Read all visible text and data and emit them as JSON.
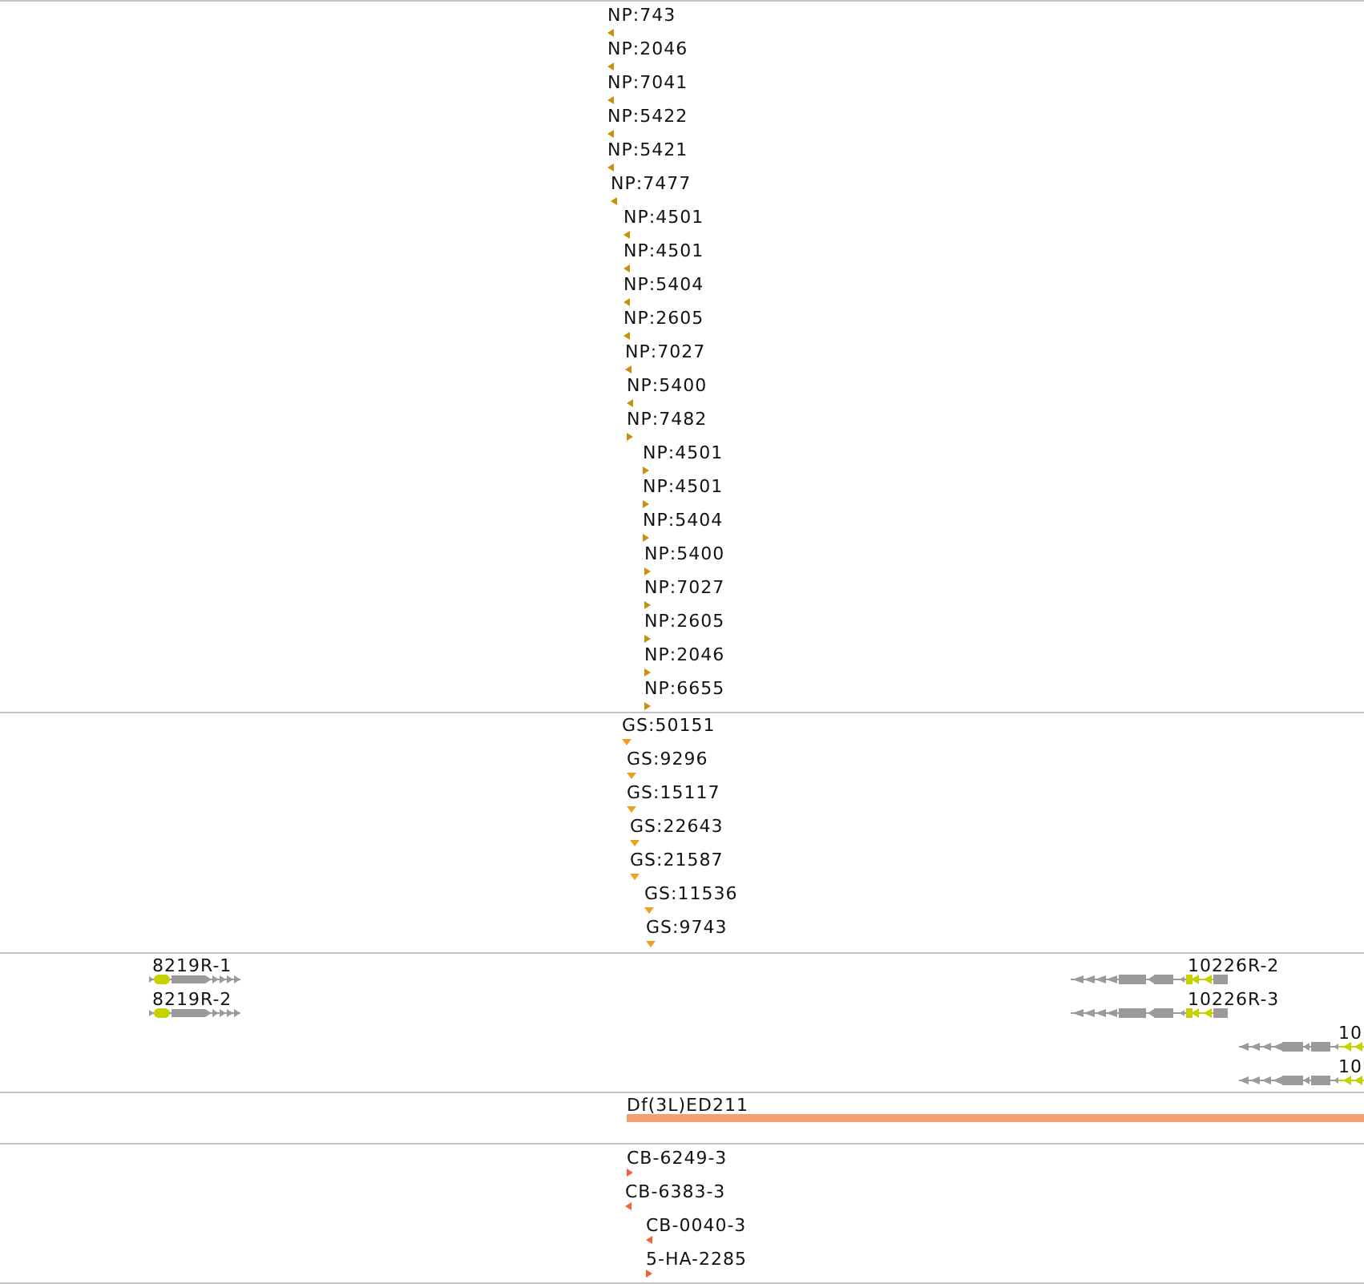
{
  "tracks": [
    {
      "kind": "point_features",
      "color": "#c8900a",
      "features": [
        {
          "label": "NP:743",
          "kind": "reverse"
        },
        {
          "label": "NP:2046",
          "kind": "reverse"
        },
        {
          "label": "NP:7041",
          "kind": "reverse"
        },
        {
          "label": "NP:5422",
          "kind": "reverse"
        },
        {
          "label": "NP:5421",
          "kind": "reverse"
        },
        {
          "label": "NP:7477",
          "kind": "reverse"
        },
        {
          "label": "NP:4501",
          "kind": "reverse"
        },
        {
          "label": "NP:4501",
          "kind": "reverse"
        },
        {
          "label": "NP:5404",
          "kind": "reverse"
        },
        {
          "label": "NP:2605",
          "kind": "reverse"
        },
        {
          "label": "NP:7027",
          "kind": "reverse"
        },
        {
          "label": "NP:5400",
          "kind": "reverse"
        },
        {
          "label": "NP:7482",
          "kind": "forward"
        },
        {
          "label": "NP:4501",
          "kind": "forward"
        },
        {
          "label": "NP:4501",
          "kind": "forward"
        },
        {
          "label": "NP:5404",
          "kind": "forward"
        },
        {
          "label": "NP:5400",
          "kind": "forward"
        },
        {
          "label": "NP:7027",
          "kind": "forward"
        },
        {
          "label": "NP:2605",
          "kind": "forward"
        },
        {
          "label": "NP:2046",
          "kind": "forward"
        },
        {
          "label": "NP:6655",
          "kind": "forward"
        }
      ]
    },
    {
      "kind": "point_features",
      "color": "#f0a020",
      "features": [
        {
          "label": "GS:50151",
          "kind": "unoriented"
        },
        {
          "label": "GS:9296",
          "kind": "unoriented"
        },
        {
          "label": "GS:15117",
          "kind": "unoriented"
        },
        {
          "label": "GS:22643",
          "kind": "unoriented"
        },
        {
          "label": "GS:21587",
          "kind": "unoriented"
        },
        {
          "label": "GS:11536",
          "kind": "unoriented"
        },
        {
          "label": "GS:9743",
          "kind": "unoriented"
        }
      ]
    },
    {
      "kind": "gene_models",
      "genes": [
        {
          "label": "8219R-1",
          "kind": "forward"
        },
        {
          "label": "10226R-2",
          "kind": "reverse"
        },
        {
          "label": "8219R-2",
          "kind": "forward"
        },
        {
          "label": "10226R-3",
          "kind": "reverse"
        },
        {
          "label": "10",
          "kind": "reverse"
        },
        {
          "label": "10",
          "kind": "reverse"
        }
      ]
    },
    {
      "kind": "region",
      "color": "#f2a06e",
      "features": [
        {
          "label": "Df(3L)ED211"
        }
      ]
    },
    {
      "kind": "point_features",
      "color": "#f2603e",
      "features": [
        {
          "label": "CB-6249-3",
          "kind": "forward"
        },
        {
          "label": "CB-6383-3",
          "kind": "reverse"
        },
        {
          "label": "CB-0040-3",
          "kind": "reverse"
        },
        {
          "label": "5-HA-2285",
          "kind": "forward"
        }
      ]
    }
  ]
}
